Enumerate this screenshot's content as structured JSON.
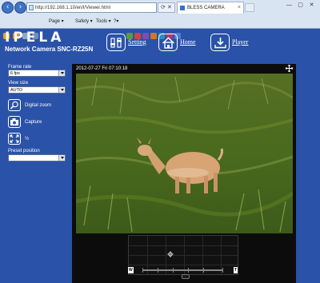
{
  "browser": {
    "address": "http://192.168.1.10/en/l/Viewer.html",
    "address_buttons": "⟳ ✕",
    "tab_title": "BLESS CAMERA",
    "command_bar": {
      "page_label": "Page ▾",
      "safety_label": "Safety ▾",
      "tools_label": "Tools ▾",
      "help_label": "?▾"
    },
    "window_controls": [
      "—",
      "▢",
      "✕"
    ]
  },
  "camera": {
    "brand": "IPELA",
    "model": "Network Camera SNC-RZ25N",
    "nav": {
      "setting_label": "Setting",
      "home_label": "Home",
      "player_label": "Player"
    },
    "left_panel": {
      "frame_rate_label": "Frame rate",
      "frame_rate_value": "6 fps",
      "view_size_label": "View size",
      "view_size_value": "AUTO",
      "digital_zoom_label": "Digital zoom",
      "capture_label": "Capture",
      "fullscreen_label": "½",
      "preset_position_label": "Preset position",
      "preset_position_value": ""
    },
    "viewer": {
      "timestamp": "2012-07-27 Fri 07:10:18",
      "zoom_wide_label": "W",
      "zoom_tele_label": "T",
      "zoom_level": 0.35
    }
  },
  "colors": {
    "page_background": "#2a52a8",
    "viewer_background": "#0c0c0c",
    "browser_chrome": "#d9e4f2"
  }
}
